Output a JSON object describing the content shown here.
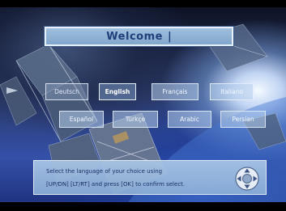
{
  "welcome": {
    "title": "Welcome",
    "caret": "|"
  },
  "languages": [
    {
      "label": "Deutsch",
      "state": "normal"
    },
    {
      "label": "English",
      "state": "normal"
    },
    {
      "label": "Français",
      "state": "normal"
    },
    {
      "label": "Italiano",
      "state": "normal"
    },
    {
      "label": "Español",
      "state": "normal"
    },
    {
      "label": "Türkçe",
      "state": "normal"
    },
    {
      "label": "Arabic",
      "state": "normal"
    },
    {
      "label": "Persian",
      "state": "normal"
    }
  ],
  "instructions": {
    "line1": "Select the language of your choice using",
    "line2": "[UP/DN] [LT/RT] and press [OK] to confirm select."
  },
  "icons": {
    "nav": "remote-navigation-pad-icon"
  }
}
